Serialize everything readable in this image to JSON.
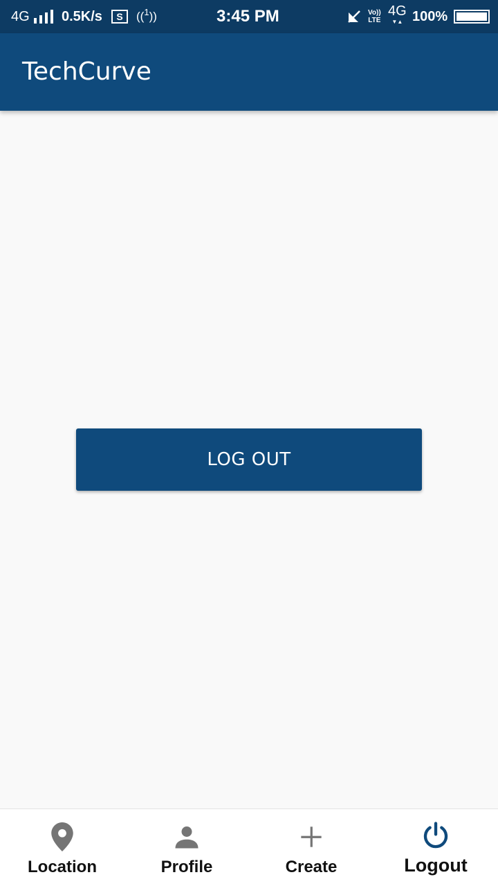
{
  "status_bar": {
    "network_left": "4G",
    "speed": "0.5K/s",
    "screenshot_badge": "S",
    "hotspot_number": "1",
    "time": "3:45 PM",
    "volte_top": "Vo))",
    "volte_bottom": "LTE",
    "network_right": "4G",
    "battery": "100%"
  },
  "app_bar": {
    "title": "TechCurve"
  },
  "main": {
    "logout_button_label": "LOG OUT"
  },
  "bottom_nav": {
    "items": [
      {
        "label": "Location",
        "icon": "location-pin-icon",
        "active": false
      },
      {
        "label": "Profile",
        "icon": "person-icon",
        "active": false
      },
      {
        "label": "Create",
        "icon": "plus-icon",
        "active": false
      },
      {
        "label": "Logout",
        "icon": "power-icon",
        "active": true
      }
    ]
  },
  "colors": {
    "status_bar": "#0d3b63",
    "primary": "#0f4a7c",
    "background": "#f9f9f9",
    "nav_icon_inactive": "#757575",
    "nav_icon_active": "#0f4a7c"
  }
}
